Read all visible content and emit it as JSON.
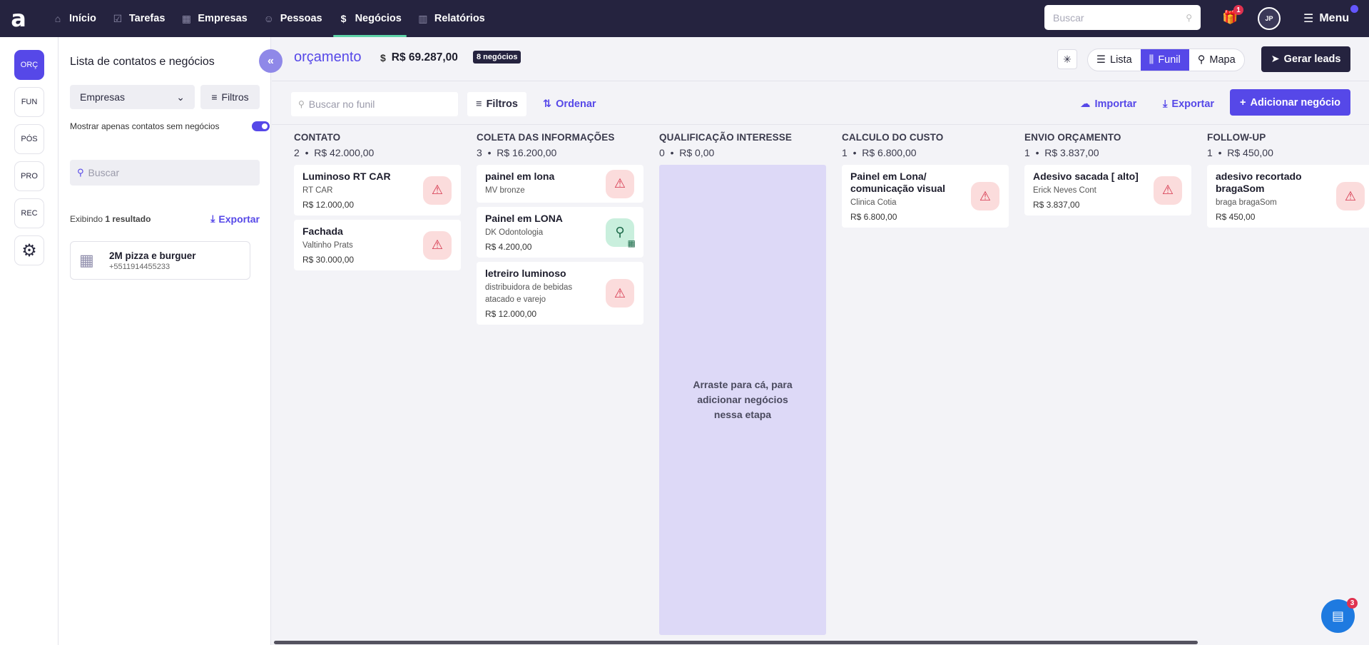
{
  "logo": "a",
  "nav": [
    {
      "icon": "home-icon",
      "glyph": "⌂",
      "label": "Início",
      "active": false
    },
    {
      "icon": "tasks-icon",
      "glyph": "☑",
      "label": "Tarefas",
      "active": false
    },
    {
      "icon": "building-icon",
      "glyph": "▦",
      "label": "Empresas",
      "active": false
    },
    {
      "icon": "person-icon",
      "glyph": "☺",
      "label": "Pessoas",
      "active": false
    },
    {
      "icon": "money-icon",
      "glyph": "$",
      "label": "Negócios",
      "active": true
    },
    {
      "icon": "chart-icon",
      "glyph": "▥",
      "label": "Relatórios",
      "active": false
    }
  ],
  "top_search": {
    "placeholder": "Buscar"
  },
  "gift_badge": "1",
  "avatar_initials": "JP",
  "menu_label": "Menu",
  "rail": [
    {
      "label": "ORÇ",
      "active": true
    },
    {
      "label": "FUN",
      "active": false
    },
    {
      "label": "PÓS",
      "active": false
    },
    {
      "label": "PRO",
      "active": false
    },
    {
      "label": "REC",
      "active": false
    }
  ],
  "panel": {
    "title": "Lista de contatos e negócios",
    "select_value": "Empresas",
    "filters_label": "Filtros",
    "toggle_label": "Mostrar apenas contatos sem negócios",
    "toggle_on": true,
    "search_placeholder": "Buscar",
    "results_prefix": "Exibindo",
    "results_count": "1 resultado",
    "export_label": "Exportar",
    "contacts": [
      {
        "name": "2M pizza e burguer",
        "phone": "+5511914455233"
      }
    ]
  },
  "header": {
    "pipeline_title": "orçamento",
    "total": "R$ 69.287,00",
    "deals_badge": "8 negócios",
    "views": [
      {
        "icon": "list-icon",
        "glyph": "☰",
        "label": "Lista",
        "active": false
      },
      {
        "icon": "funnel-icon",
        "glyph": "⫼",
        "label": "Funil",
        "active": true
      },
      {
        "icon": "map-icon",
        "glyph": "⚲",
        "label": "Mapa",
        "active": false
      }
    ],
    "leads_label": "Gerar leads"
  },
  "toolbar": {
    "search_placeholder": "Buscar no funil",
    "filters_label": "Filtros",
    "sort_label": "Ordenar",
    "import_label": "Importar",
    "export_label": "Exportar",
    "add_label": "Adicionar negócio"
  },
  "columns": [
    {
      "title": "CONTATO",
      "count": "2",
      "total": "R$ 42.000,00",
      "cards": [
        {
          "title": "Luminoso RT CAR",
          "sub": "RT CAR",
          "value": "R$ 12.000,00",
          "status": "alert"
        },
        {
          "title": "Fachada",
          "sub": "Valtinho Prats",
          "value": "R$ 30.000,00",
          "status": "alert"
        }
      ]
    },
    {
      "title": "COLETA DAS INFORMAÇÕES",
      "count": "3",
      "total": "R$ 16.200,00",
      "cards": [
        {
          "title": "painel em lona",
          "sub": "MV bronze",
          "value": "",
          "status": "alert"
        },
        {
          "title": "Painel em LONA",
          "sub": "DK Odontologia",
          "value": "R$ 4.200,00",
          "status": "scheduled"
        },
        {
          "title": "letreiro luminoso",
          "sub": "distribuidora de bebidas atacado e varejo",
          "value": "R$ 12.000,00",
          "status": "alert"
        }
      ]
    },
    {
      "title": "QUALIFICAÇÃO INTERESSE",
      "count": "0",
      "total": "R$ 0,00",
      "cards": [],
      "empty_text": "Arraste para cá, para adicionar negócios nessa etapa"
    },
    {
      "title": "CALCULO DO CUSTO",
      "count": "1",
      "total": "R$ 6.800,00",
      "cards": [
        {
          "title": "Painel em Lona/ comunicação visual",
          "sub": "Clinica Cotia",
          "value": "R$ 6.800,00",
          "status": "alert"
        }
      ]
    },
    {
      "title": "ENVIO ORÇAMENTO",
      "count": "1",
      "total": "R$ 3.837,00",
      "cards": [
        {
          "title": "Adesivo sacada [ alto]",
          "sub": "Erick Neves Cont",
          "value": "R$ 3.837,00",
          "status": "alert"
        }
      ]
    },
    {
      "title": "FOLLOW-UP",
      "count": "1",
      "total": "R$ 450,00",
      "cards": [
        {
          "title": "adesivo recortado bragaSom",
          "sub": "braga bragaSom",
          "value": "R$ 450,00",
          "status": "alert"
        }
      ]
    }
  ],
  "chat_badge": "3",
  "colors": {
    "accent": "#5648e8",
    "nav_bg": "#25233f",
    "alert": "#d5344b",
    "success": "#1d6a4a"
  }
}
